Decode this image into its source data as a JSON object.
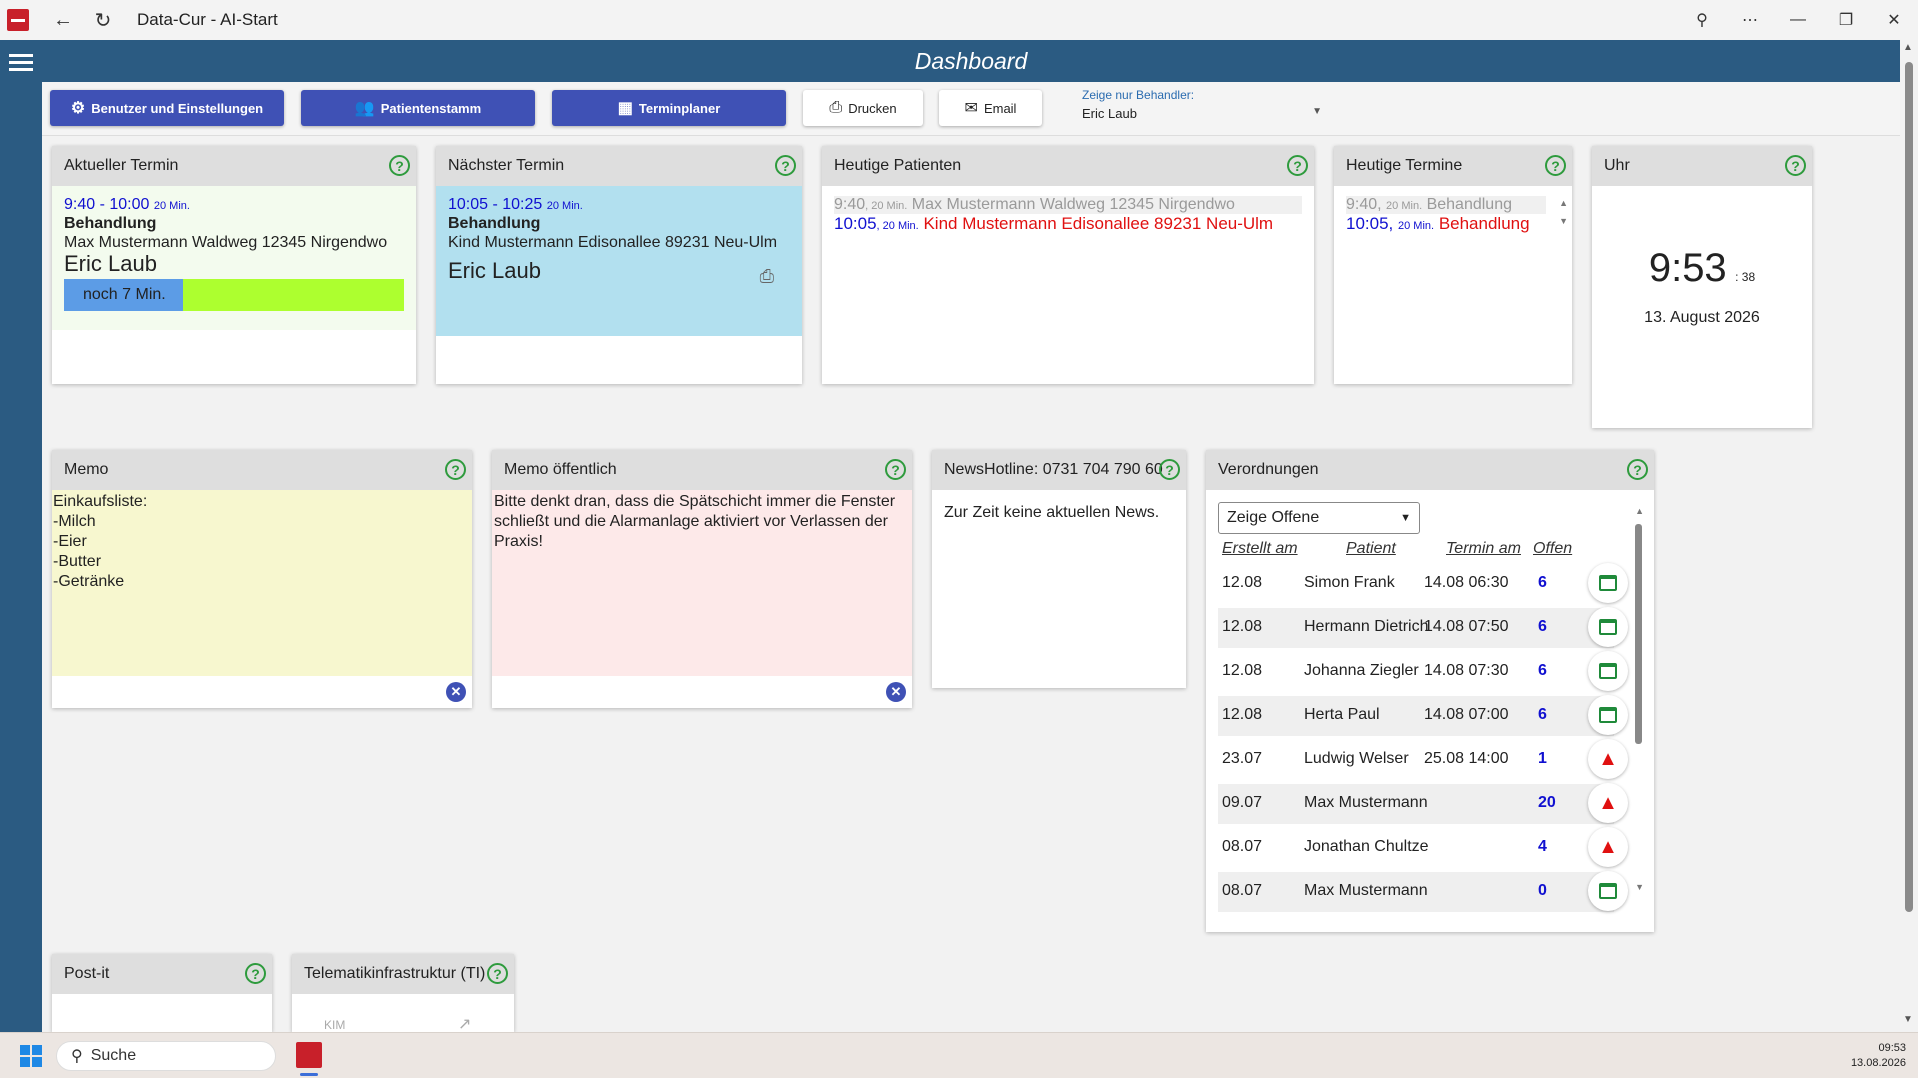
{
  "window": {
    "title": "Data-Cur - AI-Start"
  },
  "header": {
    "title": "Dashboard"
  },
  "toolbar": {
    "users_settings": "Benutzer und Einstellungen",
    "patients": "Patientenstamm",
    "scheduler": "Terminplaner",
    "print": "Drucken",
    "email": "Email",
    "filter_label": "Zeige nur Behandler:",
    "filter_value": "Eric Laub"
  },
  "current_appointment": {
    "title": "Aktueller Termin",
    "time": "9:40 - 10:00",
    "duration": "20 Min.",
    "type": "Behandlung",
    "patient": "Max Mustermann Waldweg 12345 Nirgendwo",
    "doctor": "Eric Laub",
    "remaining": "noch 7 Min.",
    "progress": 0.35
  },
  "next_appointment": {
    "title": "Nächster Termin",
    "time": "10:05 - 10:25",
    "duration": "20 Min.",
    "type": "Behandlung",
    "patient": "Kind Mustermann Edisonallee 89231 Neu-Ulm",
    "doctor": "Eric Laub"
  },
  "today_patients": {
    "title": "Heutige Patienten",
    "rows": [
      {
        "time": "9:40",
        "duration": ", 20 Min.",
        "text": "Max Mustermann Waldweg 12345 Nirgendwo"
      },
      {
        "time": "10:05",
        "duration": ", 20 Min.",
        "text": "Kind Mustermann Edisonallee 89231 Neu-Ulm"
      }
    ]
  },
  "today_appointments": {
    "title": "Heutige Termine",
    "rows": [
      {
        "time": "9:40,",
        "duration": "20 Min.",
        "text": "Behandlung"
      },
      {
        "time": "10:05,",
        "duration": "20 Min.",
        "text": "Behandlung"
      }
    ]
  },
  "clock": {
    "title": "Uhr",
    "time": "9:53",
    "seconds": ": 38",
    "date": "13. August 2026"
  },
  "memo": {
    "title": "Memo",
    "text": "Einkaufsliste:\n-Milch\n-Eier\n-Butter\n-Getränke"
  },
  "memo_public": {
    "title": "Memo öffentlich",
    "text": "Bitte denkt dran, dass die Spätschicht immer die Fenster schließt und die Alarmanlage aktiviert vor Verlassen der Praxis!"
  },
  "news": {
    "title": "NewsHotline: 0731 704 790 60",
    "text": "Zur Zeit keine aktuellen News."
  },
  "prescriptions": {
    "title": "Verordnungen",
    "filter": "Zeige Offene",
    "columns": [
      "Erstellt am",
      "Patient",
      "Termin am",
      "Offen"
    ],
    "rows": [
      {
        "created": "12.08",
        "patient": "Simon Frank",
        "appointment": "14.08 06:30",
        "open": "6",
        "icon": "calendar-icon"
      },
      {
        "created": "12.08",
        "patient": "Hermann Dietrich",
        "appointment": "14.08 07:50",
        "open": "6",
        "icon": "calendar-icon"
      },
      {
        "created": "12.08",
        "patient": "Johanna Ziegler",
        "appointment": "14.08 07:30",
        "open": "6",
        "icon": "calendar-icon"
      },
      {
        "created": "12.08",
        "patient": "Herta Paul",
        "appointment": "14.08 07:00",
        "open": "6",
        "icon": "calendar-icon"
      },
      {
        "created": "23.07",
        "patient": "Ludwig Welser",
        "appointment": "25.08 14:00",
        "open": "1",
        "icon": "warning-icon"
      },
      {
        "created": "09.07",
        "patient": "Max Mustermann",
        "appointment": "",
        "open": "20",
        "icon": "warning-icon"
      },
      {
        "created": "08.07",
        "patient": "Jonathan Chultze",
        "appointment": "",
        "open": "4",
        "icon": "warning-icon"
      },
      {
        "created": "08.07",
        "patient": "Max Mustermann",
        "appointment": "",
        "open": "0",
        "icon": "calendar-icon"
      }
    ]
  },
  "postit": {
    "title": "Post-it"
  },
  "ti": {
    "title": "Telematikinfrastruktur (TI)",
    "kim": "KIM"
  },
  "taskbar": {
    "search": "Suche",
    "time": "09:53",
    "date": "13.08.2026"
  },
  "colors": {
    "header": "#2b5b82",
    "button_blue": "#3f51b5",
    "help_green": "#2e9b3d",
    "current_bg": "#f3fbee",
    "next_bg": "#b2e0ef",
    "memo_bg": "#f7f7cf",
    "memo_public_bg": "#fde9e9",
    "progress_green": "#adff2f",
    "progress_blue": "#5c9ce6"
  }
}
